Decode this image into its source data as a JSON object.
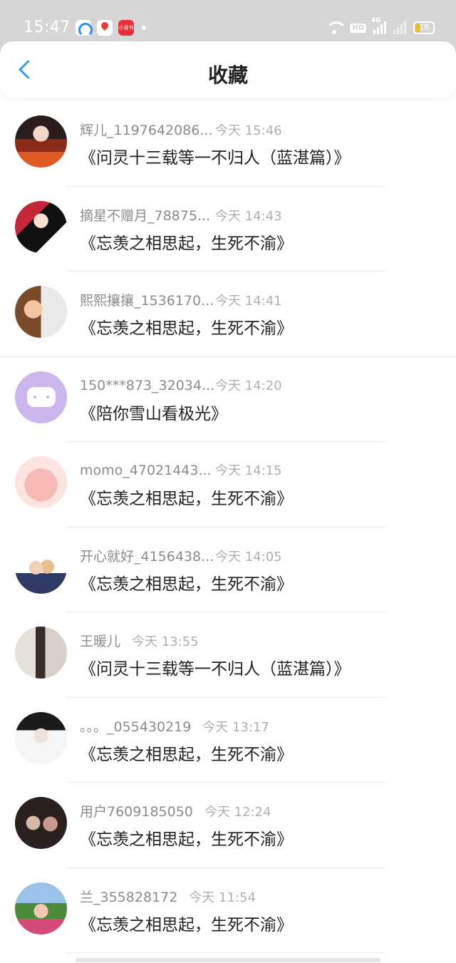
{
  "status_bar": {
    "time": "15:47",
    "app_icons": [
      "browser-icon",
      "map-icon",
      "novel-app-icon"
    ],
    "red_app_label": "小说书",
    "hd_label": "HD",
    "network_label": "4G",
    "battery_percent": "18"
  },
  "header": {
    "title": "收藏",
    "back_icon": "chevron-left-icon",
    "accent_color": "#2f9df0"
  },
  "items": [
    {
      "username": "辉儿_1197642086...",
      "time": "今天 15:46",
      "title": "《问灵十三载等一不归人（蓝湛篇）》"
    },
    {
      "username": "摘星不赠月_78875...",
      "time": "今天 14:43",
      "title": "《忘羡之相思起，生死不渝》"
    },
    {
      "username": "熙熙攘攘_1536170...",
      "time": "今天 14:41",
      "title": "《忘羡之相思起，生死不渝》"
    },
    {
      "username": "150***873_32034...",
      "time": "今天 14:20",
      "title": "《陪你雪山看极光》"
    },
    {
      "username": "momo_47021443...",
      "time": "今天 14:15",
      "title": "《忘羡之相思起，生死不渝》"
    },
    {
      "username": "开心就好_4156438...",
      "time": "今天 14:05",
      "title": "《忘羡之相思起，生死不渝》"
    },
    {
      "username": "王暖儿",
      "time": "今天 13:55",
      "title": "《问灵十三载等一不归人（蓝湛篇）》"
    },
    {
      "username": "。。。_055430219",
      "time": "今天 13:17",
      "title": "《忘羡之相思起，生死不渝》"
    },
    {
      "username": "用户7609185050",
      "time": "今天 12:24",
      "title": "《忘羡之相思起，生死不渝》"
    },
    {
      "username": "兰_355828172",
      "time": "今天 11:54",
      "title": "《忘羡之相思起，生死不渝》"
    }
  ]
}
